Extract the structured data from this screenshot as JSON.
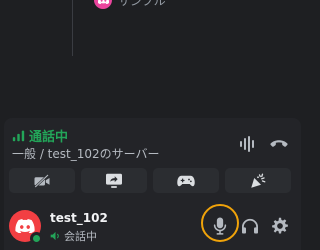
{
  "top": {
    "name": "サンプル"
  },
  "voice": {
    "status": "通話中",
    "channel": "一般 / test_102のサーバー",
    "icons": {
      "signal": "signal-bars-icon",
      "soundboard": "soundboard-icon",
      "disconnect": "phone-hangup-icon"
    },
    "actions": [
      {
        "name": "camera-off-icon"
      },
      {
        "name": "screen-share-icon"
      },
      {
        "name": "activities-gamepad-icon"
      },
      {
        "name": "soundboard-party-icon"
      }
    ]
  },
  "user": {
    "name": "test_102",
    "status": "会話中",
    "status_color": "#23a559",
    "avatar_color": "#f23f43",
    "controls": [
      "microphone-icon",
      "headphones-icon",
      "settings-gear-icon"
    ],
    "highlight_color": "#f0a30a"
  }
}
